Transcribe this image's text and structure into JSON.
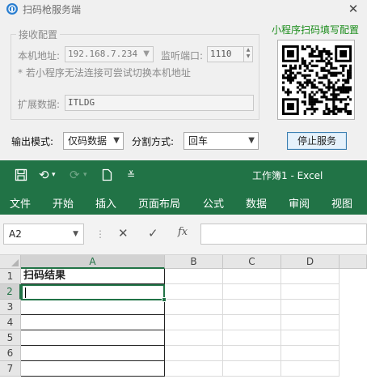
{
  "service_window": {
    "title": "扫码枪服务端",
    "close_glyph": "✕",
    "group_label": "接收配置",
    "local_addr_label": "本机地址:",
    "local_addr_value": "192.168.7.234",
    "port_label": "监听端口:",
    "port_value": "1110",
    "hint": "* 若小程序无法连接可尝试切换本机地址",
    "ext_label": "扩展数据:",
    "ext_value": "ITLDG",
    "qr_title": "小程序扫码填写配置",
    "output_mode_label": "输出模式:",
    "output_mode_value": "仅码数据",
    "split_label": "分割方式:",
    "split_value": "回车",
    "stop_button": "停止服务"
  },
  "excel": {
    "quick_access": {
      "save_icon": "save-icon",
      "undo_icon": "undo-icon",
      "redo_icon": "redo-icon",
      "new_icon": "new-file-icon",
      "customize_icon": "customize-icon"
    },
    "title": "工作簿1  -  Excel",
    "menu": [
      "文件",
      "开始",
      "插入",
      "页面布局",
      "公式",
      "数据",
      "审阅",
      "视图"
    ],
    "name_box": "A2",
    "formula_icons": {
      "cancel": "✕",
      "enter": "✓",
      "fx": "fx"
    },
    "formula_value": "",
    "columns": [
      "A",
      "B",
      "C",
      "D"
    ],
    "rows": [
      "1",
      "2",
      "3",
      "4",
      "5",
      "6",
      "7"
    ],
    "cells": {
      "A1": "扫码结果",
      "A2": ""
    },
    "active_cell": "A2",
    "colors": {
      "accent": "#217346"
    }
  }
}
